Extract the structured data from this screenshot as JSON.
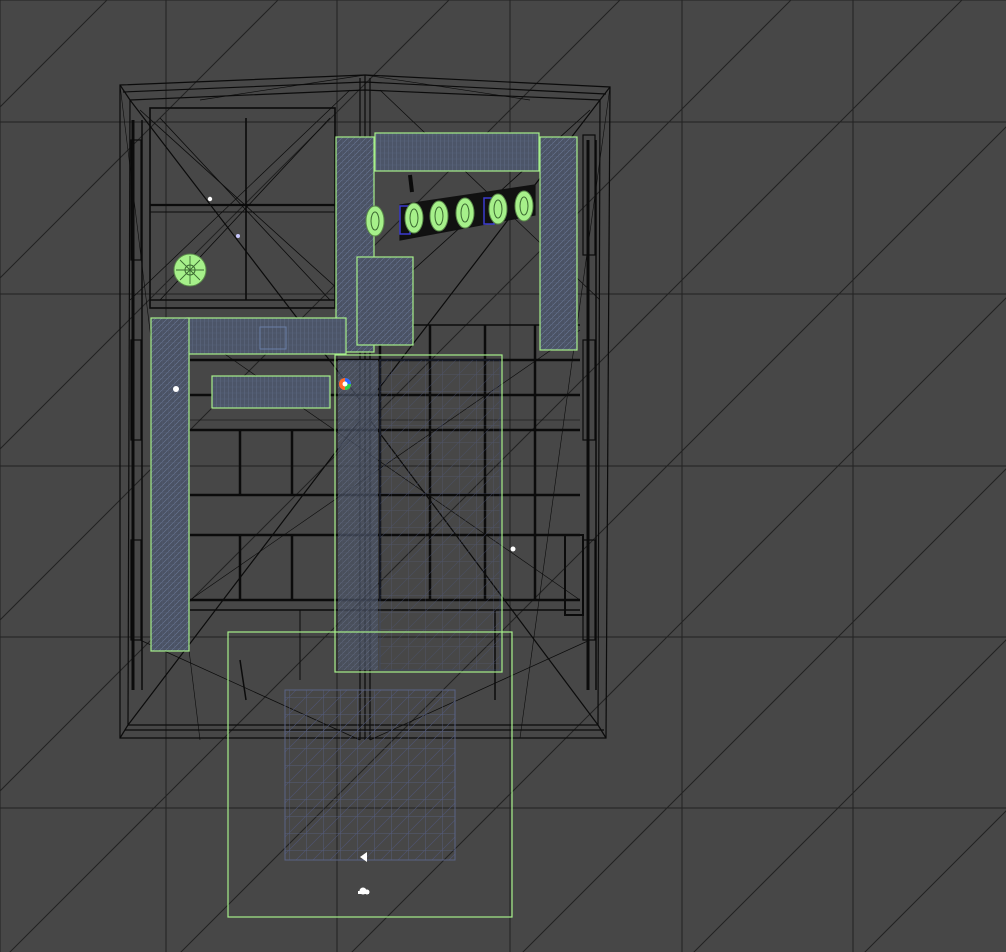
{
  "viewport": {
    "background_color": "#474747",
    "grid_line_color": "#222222",
    "wireframe_color": "#0a0a0a",
    "selection_color": "#a6f08a",
    "mesh_fill_color": "#4c5568",
    "mesh_line_color": "#5d6b86",
    "helper_color": "#3b3bd0",
    "light_color": "#ffffff"
  }
}
